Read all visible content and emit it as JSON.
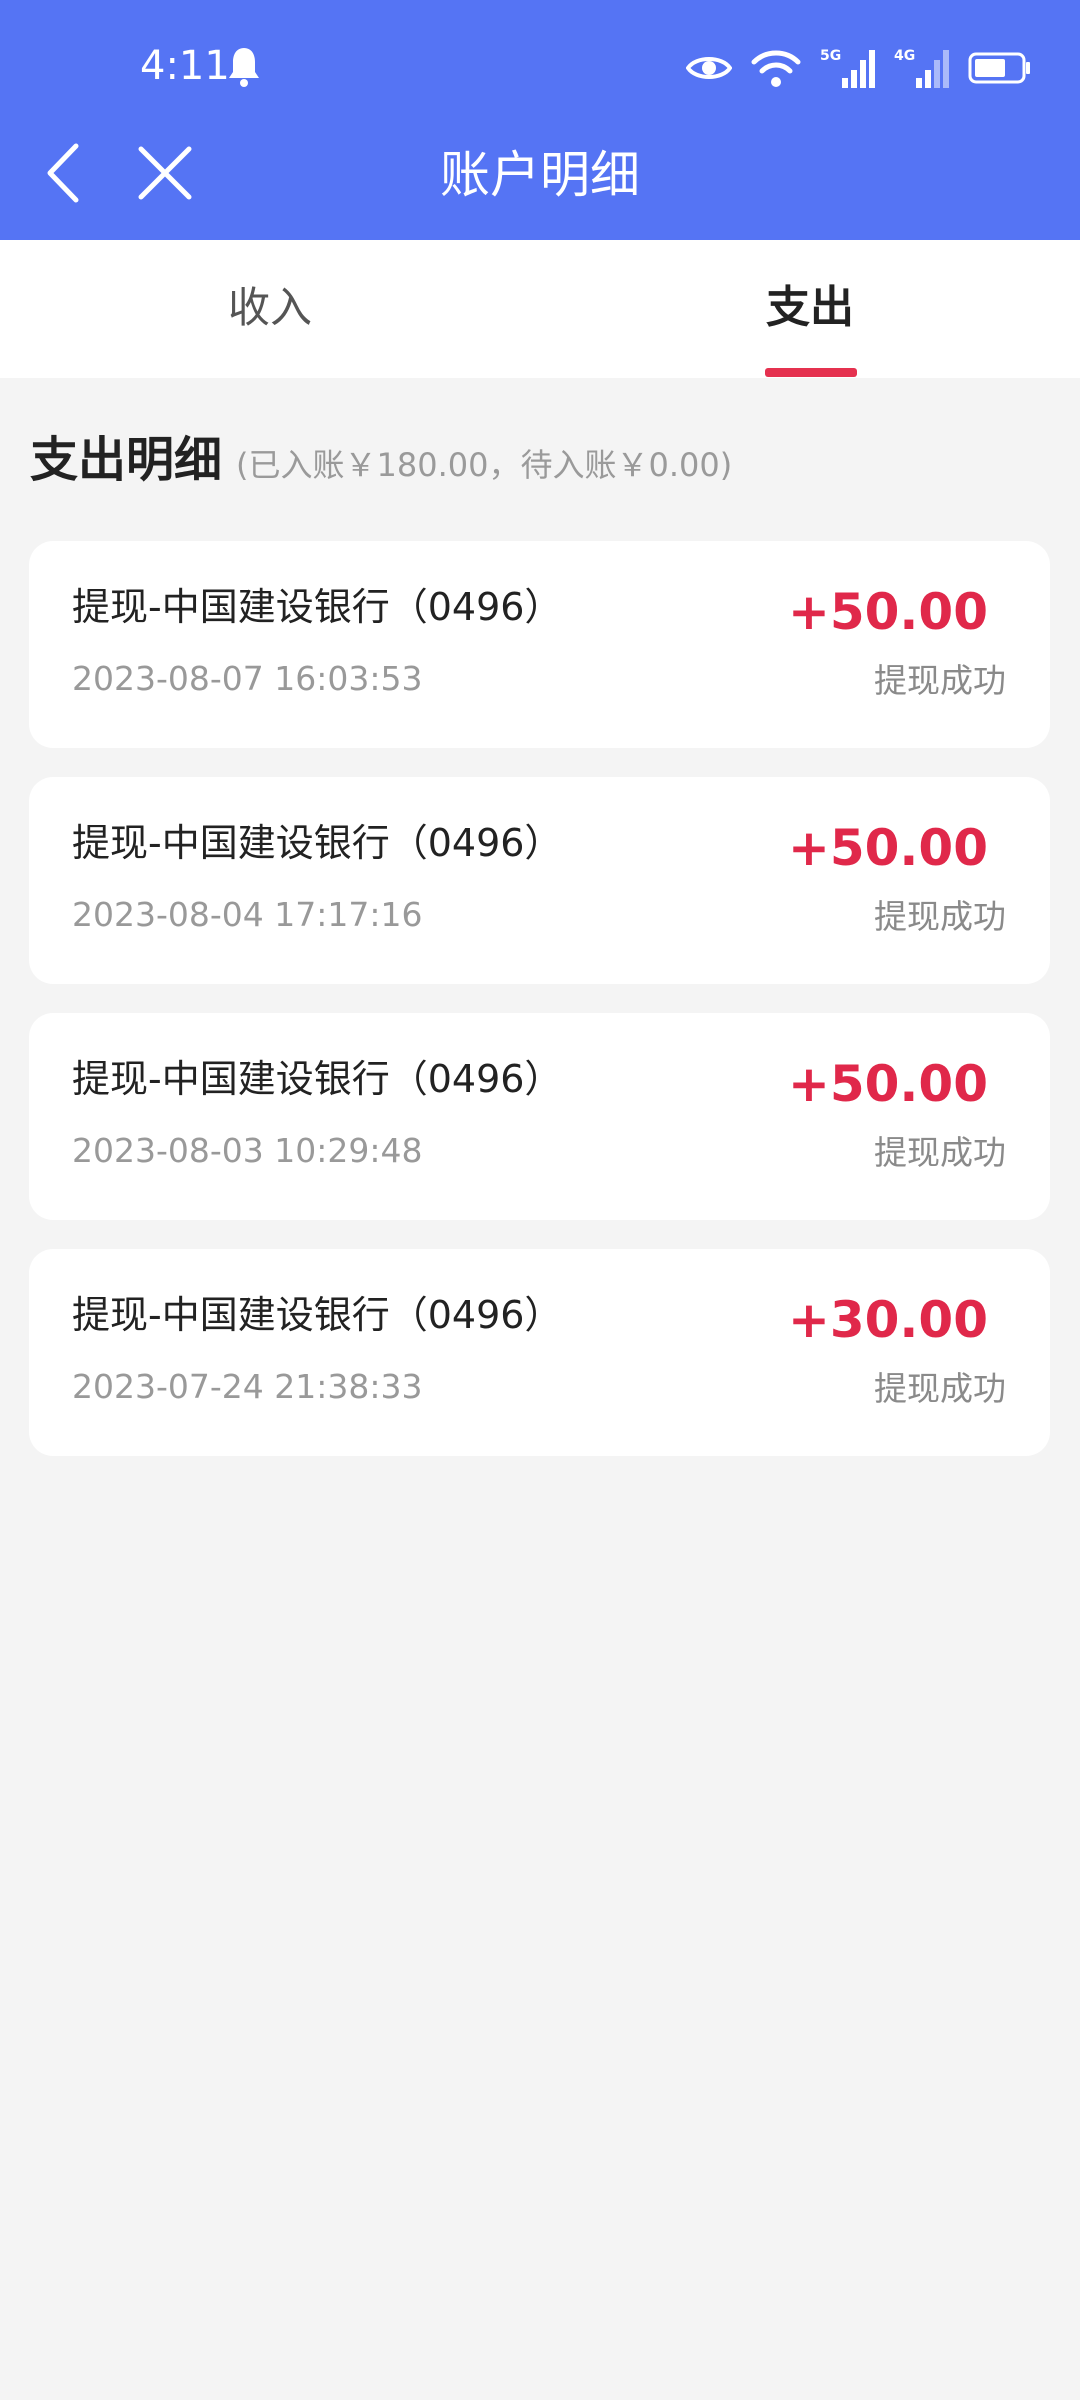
{
  "status_bar": {
    "time": "4:11",
    "icons": [
      "bell-icon",
      "eye-icon",
      "wifi-icon",
      "signal-5g-icon",
      "signal-4g-icon",
      "battery-icon"
    ]
  },
  "header": {
    "title": "账户明细",
    "background_color": "#5574f4"
  },
  "tabs": [
    {
      "label": "收入",
      "active": false
    },
    {
      "label": "支出",
      "active": true
    }
  ],
  "accent_color": "#e0284a",
  "section": {
    "title": "支出明细",
    "summary": "(已入账￥180.00，待入账￥0.00)"
  },
  "records": [
    {
      "name": "提现-中国建设银行（0496）",
      "time": "2023-08-07 16:03:53",
      "amount": "+50.00",
      "status": "提现成功"
    },
    {
      "name": "提现-中国建设银行（0496）",
      "time": "2023-08-04 17:17:16",
      "amount": "+50.00",
      "status": "提现成功"
    },
    {
      "name": "提现-中国建设银行（0496）",
      "time": "2023-08-03 10:29:48",
      "amount": "+50.00",
      "status": "提现成功"
    },
    {
      "name": "提现-中国建设银行（0496）",
      "time": "2023-07-24 21:38:33",
      "amount": "+30.00",
      "status": "提现成功"
    }
  ]
}
